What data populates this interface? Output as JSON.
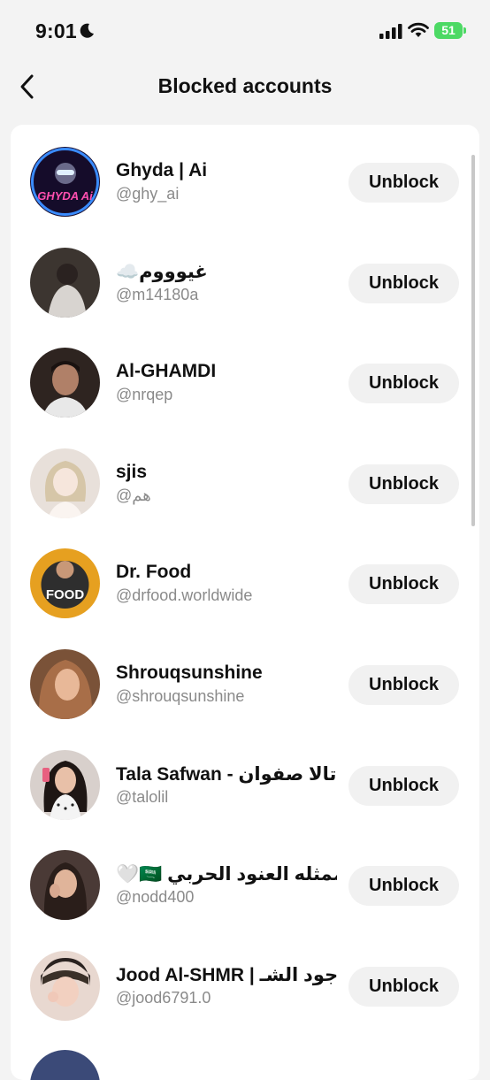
{
  "status_bar": {
    "time": "9:01",
    "battery": "51"
  },
  "nav": {
    "title": "Blocked accounts"
  },
  "accounts": [
    {
      "name": "Ghyda | Ai",
      "handle": "@ghy_ai",
      "button": "Unblock",
      "avatar_color": "#1a1030",
      "avatar_text": "GHYDA Ai"
    },
    {
      "name": "☁️غيوووم",
      "handle": "@m14180a",
      "button": "Unblock",
      "avatar_color": "#3c3530"
    },
    {
      "name": "Al-GHAMDI",
      "handle": "@nrqep",
      "button": "Unblock",
      "avatar_color": "#2e2420"
    },
    {
      "name": "sjis",
      "handle": "@هم",
      "button": "Unblock",
      "avatar_color": "#d8cfc8"
    },
    {
      "name": "Dr. Food",
      "handle": "@drfood.worldwide",
      "button": "Unblock",
      "avatar_color": "#e6a020",
      "avatar_text": "FOOD"
    },
    {
      "name": "Shrouqsunshine",
      "handle": "@shrouqsunshine",
      "button": "Unblock",
      "avatar_color": "#8a5a3c"
    },
    {
      "name": "Tala Safwan - تالا صفوان...",
      "handle": "@talolil",
      "button": "Unblock",
      "avatar_color": "#2a2220"
    },
    {
      "name": "🤍🇸🇦 الممثله العنود الحربي",
      "handle": "@nodd400",
      "button": "Unblock",
      "avatar_color": "#3a3030"
    },
    {
      "name": "Jood Al-SHMR | جود الشـ...",
      "handle": "@jood6791.0",
      "button": "Unblock",
      "avatar_color": "#c89080"
    }
  ]
}
